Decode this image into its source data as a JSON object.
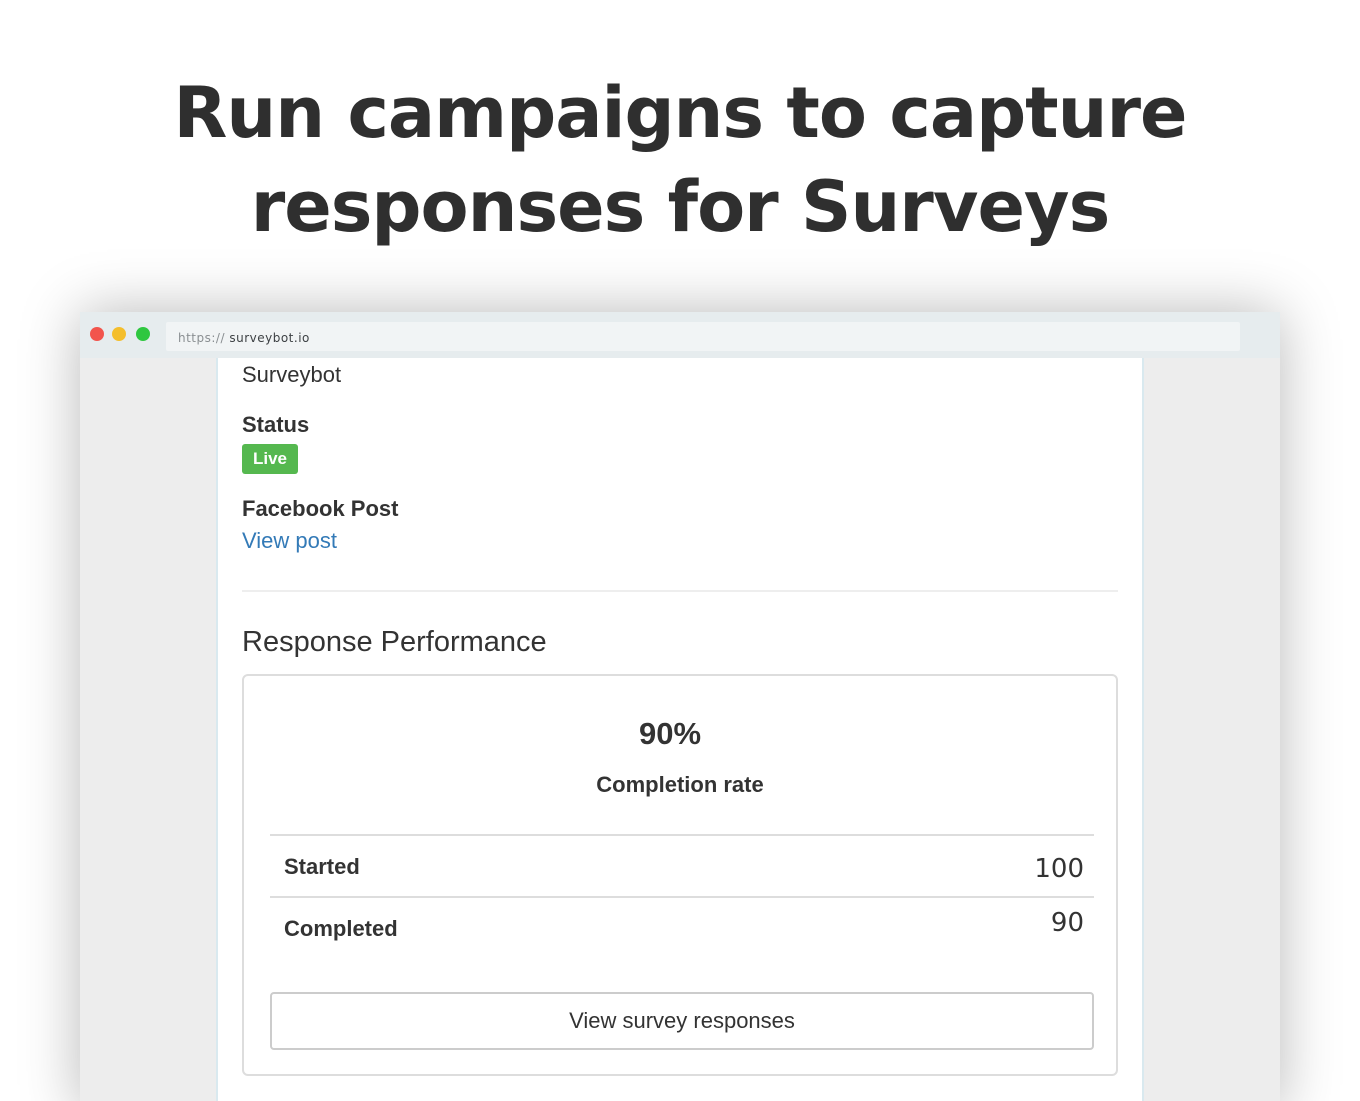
{
  "headline": {
    "line1": "Run campaigns to capture",
    "line2": "responses for Surveys"
  },
  "browser": {
    "url_scheme": "https://",
    "url_host": "surveybot.io"
  },
  "campaign": {
    "app_name": "Surveybot",
    "status_label": "Status",
    "status_badge": "Live",
    "facebook_post_label": "Facebook Post",
    "view_post_link": "View post"
  },
  "performance": {
    "title": "Response Performance",
    "completion_value": "90%",
    "completion_label": "Completion rate",
    "rows": [
      {
        "name": "Started",
        "value": "100"
      },
      {
        "name": "Completed",
        "value": "90"
      }
    ],
    "button_label": "View survey responses"
  },
  "colors": {
    "live_badge": "#55b84f",
    "link": "#337ab7",
    "traffic_red": "#f2544c",
    "traffic_yellow": "#f4be2c",
    "traffic_green": "#2ec73f"
  }
}
